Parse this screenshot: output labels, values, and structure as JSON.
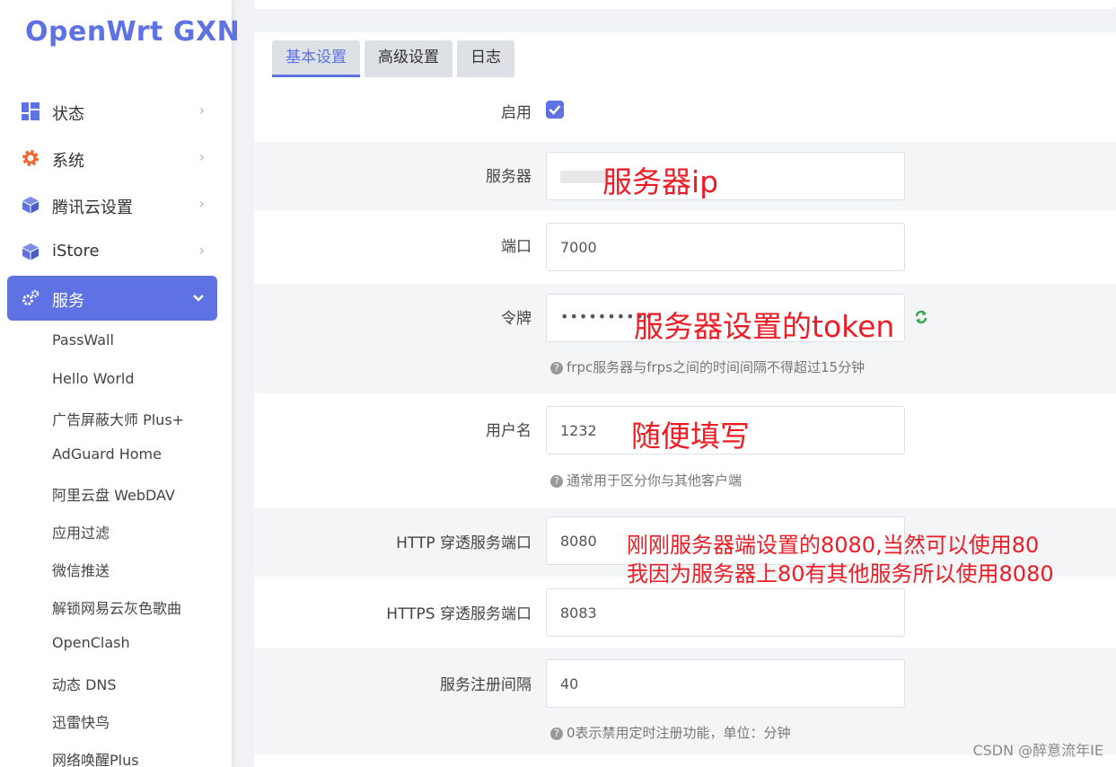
{
  "brand": "OpenWrt GXN",
  "sidebar": {
    "menu": [
      {
        "label": "状态",
        "icon": "dashboard-icon"
      },
      {
        "label": "系统",
        "icon": "gear-icon"
      },
      {
        "label": "腾讯云设置",
        "icon": "cube-icon"
      },
      {
        "label": "iStore",
        "icon": "cube-icon"
      },
      {
        "label": "服务",
        "icon": "gears-icon",
        "expanded": true
      }
    ],
    "submenu": [
      "PassWall",
      "Hello World",
      "广告屏蔽大师 Plus+",
      "AdGuard Home",
      "阿里云盘 WebDAV",
      "应用过滤",
      "微信推送",
      "解锁网易云灰色歌曲",
      "OpenClash",
      "动态 DNS",
      "迅雷快鸟",
      "网络唤醒Plus"
    ]
  },
  "tabs": [
    "基本设置",
    "高级设置",
    "日志"
  ],
  "form": {
    "enable_label": "启用",
    "server_label": "服务器",
    "port_label": "端口",
    "port_value": "7000",
    "token_label": "令牌",
    "token_value": "••••••••••",
    "token_hint": "frpc服务器与frps之间的时间间隔不得超过15分钟",
    "user_label": "用户名",
    "user_value": "1232",
    "user_hint": "通常用于区分你与其他客户端",
    "http_label": "HTTP 穿透服务端口",
    "http_value": "8080",
    "https_label": "HTTPS 穿透服务端口",
    "https_value": "8083",
    "interval_label": "服务注册间隔",
    "interval_value": "40",
    "interval_hint": "0表示禁用定时注册功能，单位：分钟"
  },
  "annotations": {
    "server": "服务器ip",
    "token": "服务器设置的token",
    "user": "随便填写",
    "http_line1": "刚刚服务器端设置的8080,当然可以使用80",
    "http_line2": "我因为服务器上80有其他服务所以使用8080"
  },
  "watermark": "CSDN @醉意流年IE",
  "colors": {
    "accent": "#5e72e4",
    "annotation": "#ee1c25",
    "refresh": "#3aa655"
  }
}
